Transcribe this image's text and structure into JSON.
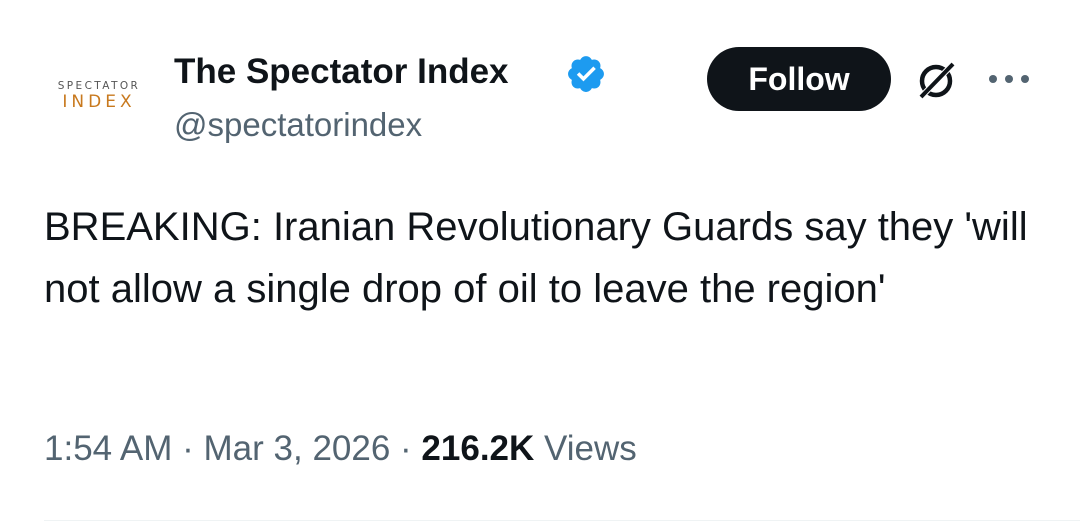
{
  "author": {
    "avatar": {
      "line1": "SPECTATOR",
      "line2": "INDEX"
    },
    "display_name": "The Spectator Index",
    "verified_icon": "verified-badge-icon",
    "handle": "@spectatorindex"
  },
  "actions": {
    "follow_label": "Follow",
    "grok_icon": "grok-icon",
    "more_icon": "more-options-icon"
  },
  "tweet": {
    "text": "BREAKING: Iranian Revolutionary Guards say they 'will not allow a single drop of oil to leave the region'"
  },
  "meta": {
    "time": "1:54 AM",
    "separator": " · ",
    "date": "Mar 3, 2026",
    "views_count": "216.2K",
    "views_label": " Views"
  },
  "colors": {
    "text": "#0f1419",
    "secondary": "#536471",
    "verified": "#1d9bf0",
    "avatar_accent": "#c8791e"
  }
}
